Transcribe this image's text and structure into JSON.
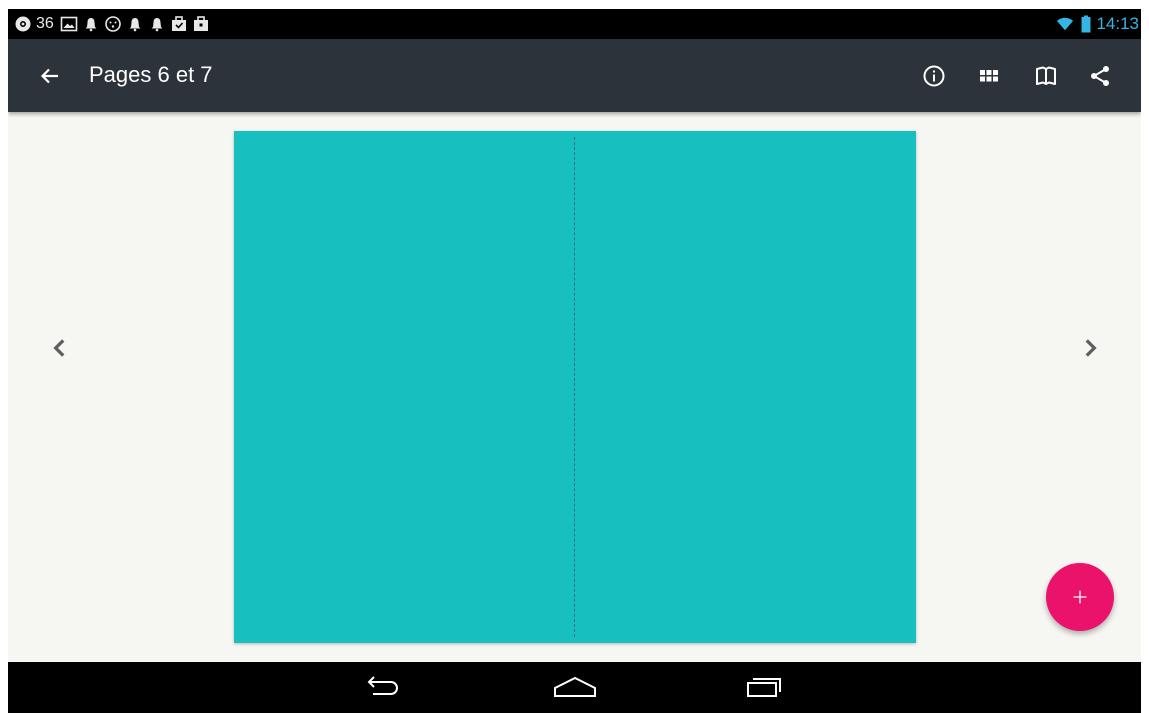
{
  "status_bar": {
    "notification_count": "36",
    "time": "14:13",
    "icons": [
      "app-icon",
      "picture-icon",
      "bell-icon",
      "face-icon",
      "bell-icon",
      "bell-icon",
      "briefcase-icon",
      "briefcase-icon"
    ],
    "right_icons": [
      "wifi-icon",
      "battery-icon"
    ]
  },
  "toolbar": {
    "title": "Pages 6 et 7",
    "back_icon": "arrow-back-icon",
    "actions": [
      "info-icon",
      "grid-icon",
      "book-icon",
      "share-icon"
    ]
  },
  "viewer": {
    "page_color": "#17bfbf",
    "prev_icon": "chevron-left-icon",
    "next_icon": "chevron-right-icon"
  },
  "fab": {
    "label": "+",
    "color": "#ea126a"
  },
  "nav_bar": {
    "buttons": [
      "back-nav-icon",
      "home-nav-icon",
      "recents-nav-icon"
    ]
  }
}
